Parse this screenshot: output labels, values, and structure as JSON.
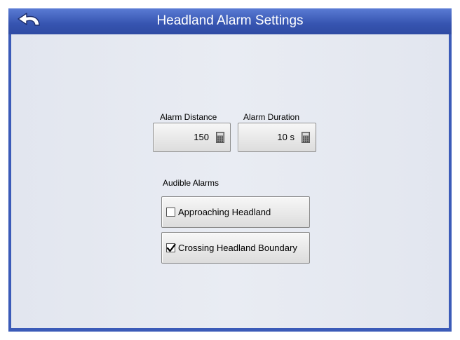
{
  "window": {
    "title": "Headland Alarm Settings"
  },
  "icons": {
    "back": "back-arrow-icon",
    "calculator": "calculator-icon",
    "checkmark": "checkmark-icon"
  },
  "colors": {
    "titlebar": "#3654b0",
    "content_background": "#e4e8f1",
    "button_face": "#e8e8e8"
  },
  "fields": {
    "alarm_distance": {
      "label": "Alarm Distance",
      "value": "150"
    },
    "alarm_duration": {
      "label": "Alarm Duration",
      "value": "10 s"
    }
  },
  "audible_alarms": {
    "label": "Audible Alarms",
    "options": [
      {
        "label": "Approaching Headland",
        "checked": false
      },
      {
        "label": "Crossing Headland Boundary",
        "checked": true
      }
    ]
  }
}
